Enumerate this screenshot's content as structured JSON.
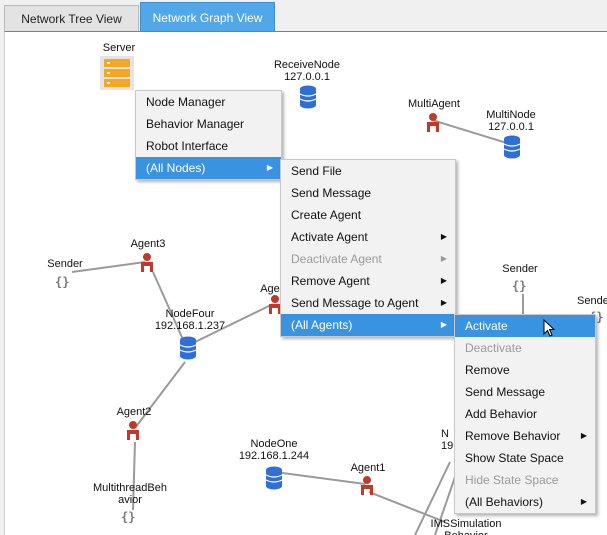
{
  "tabs": [
    {
      "label": "Network Tree View"
    },
    {
      "label": "Network Graph View"
    }
  ],
  "nodes": {
    "server": "Server",
    "receive_node": "ReceiveNode\n127.0.0.1",
    "multi_agent": "MultiAgent",
    "multi_node": "MultiNode\n127.0.0.1",
    "sender_left": "Sender",
    "agent3": "Agent3",
    "node_four": "NodeFour\n192.168.1.237",
    "agent_partial": "Age",
    "sender_right": "Sender",
    "sender_far_right": "Sende",
    "agent2": "Agent2",
    "node_one": "NodeOne\n192.168.1.244",
    "agent1": "Agent1",
    "multithread": "MultithreadBeh\navior",
    "ims_sim": "IMSSimulation\nBehavior",
    "partial_n": "N\n19"
  },
  "brace_glyph": "{}",
  "menu1": {
    "items": [
      "Node Manager",
      "Behavior Manager",
      "Robot Interface",
      "(All Nodes)"
    ]
  },
  "menu2": {
    "items": [
      "Send File",
      "Send Message",
      "Create Agent",
      "Activate Agent",
      "Deactivate Agent",
      "Remove Agent",
      "Send Message to Agent",
      "(All Agents)"
    ]
  },
  "menu3": {
    "items": [
      "Activate",
      "Deactivate",
      "Remove",
      "Send Message",
      "Add Behavior",
      "Remove Behavior",
      "Show State Space",
      "Hide State Space",
      "(All Behaviors)"
    ]
  },
  "arrow_glyph": "▶",
  "colors": {
    "accent": "#52a7e8",
    "agent": "#c0392b",
    "db": "#2f6fd6",
    "server": "#f5a623",
    "selected": "#3a93e0"
  }
}
